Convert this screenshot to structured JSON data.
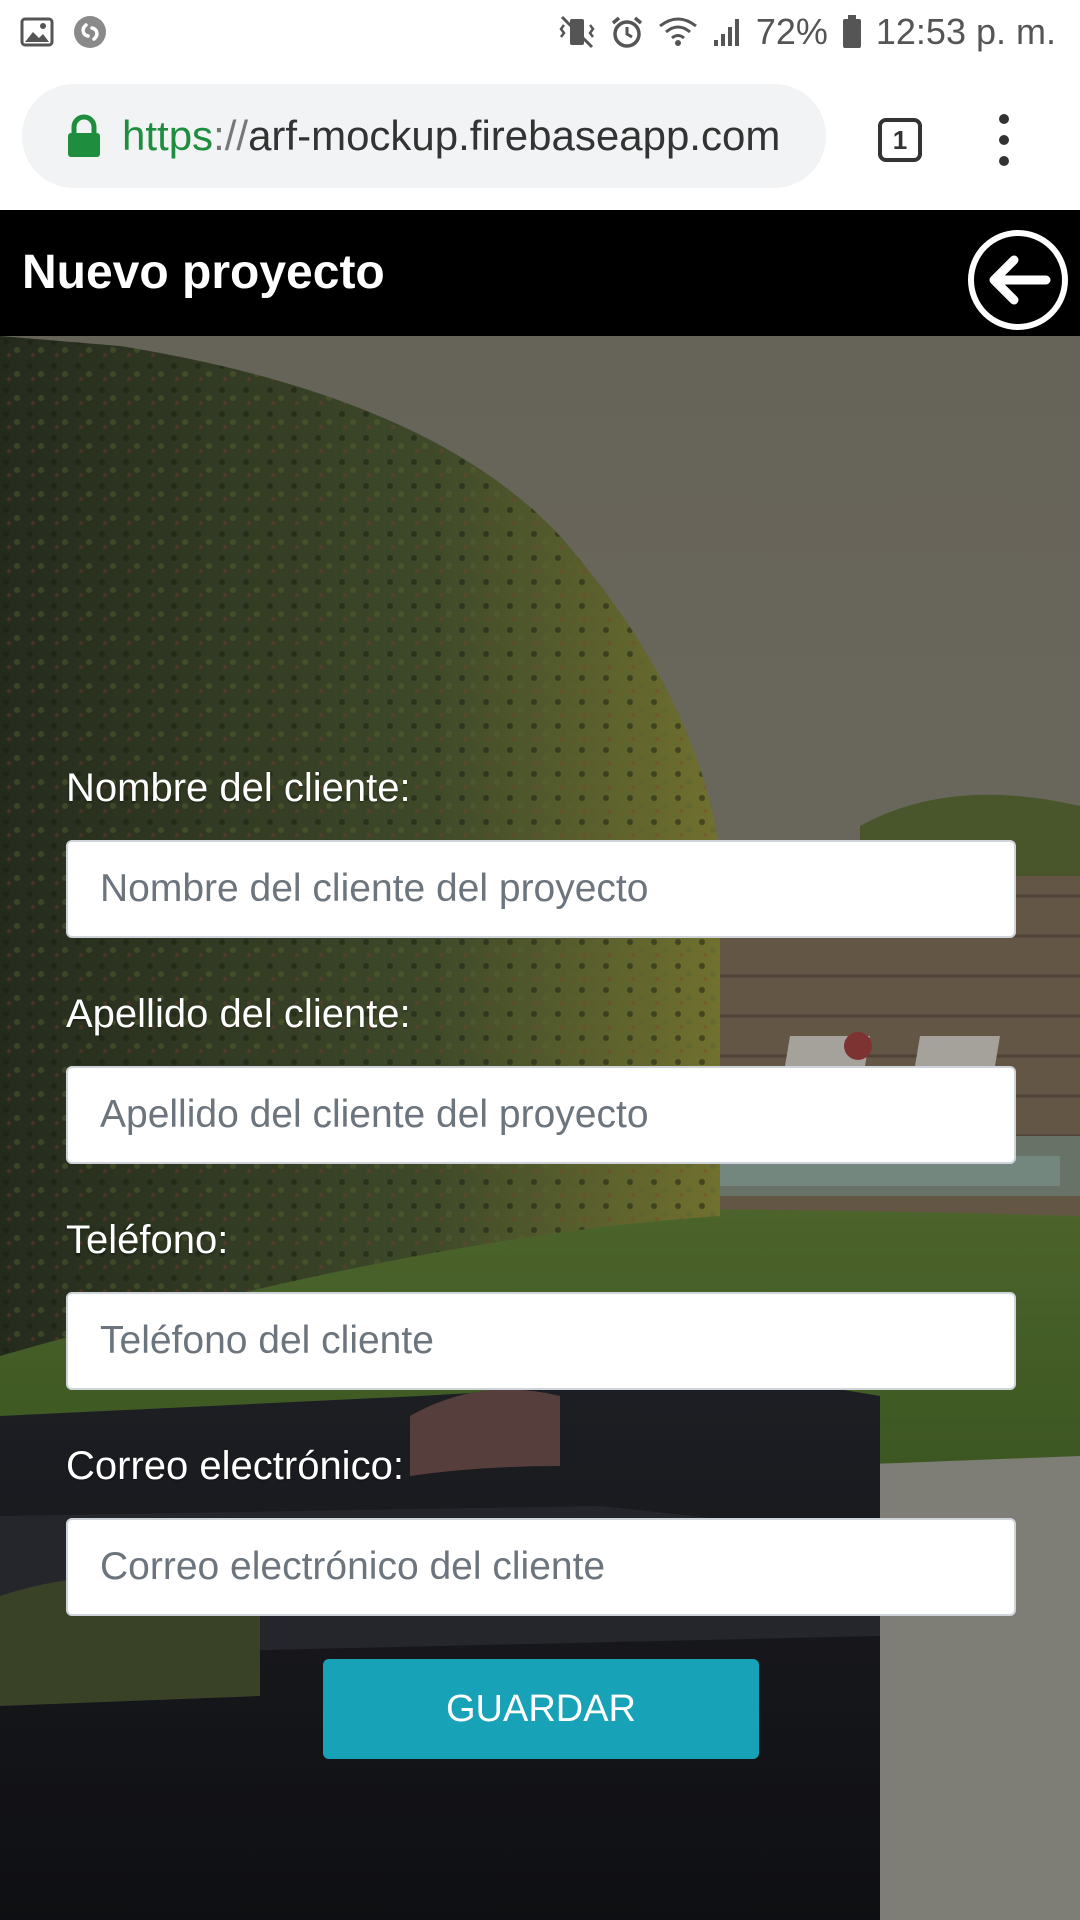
{
  "status_bar": {
    "battery": "72%",
    "time": "12:53 p. m.",
    "icons": [
      "image-icon",
      "shazam-icon",
      "vibrate-mute-icon",
      "alarm-icon",
      "wifi-icon",
      "signal-icon",
      "battery-icon"
    ]
  },
  "browser": {
    "url_scheme": "https",
    "url_separator": "://",
    "url_host": "arf-mockup.firebaseapp.com",
    "tab_count": "1",
    "icons": [
      "lock-icon",
      "tabs-icon",
      "more-vert-icon"
    ]
  },
  "header": {
    "title": "Nuevo proyecto",
    "back_icon": "arrow-left-circle-icon"
  },
  "form": {
    "fields": [
      {
        "label": "Nombre del cliente:",
        "placeholder": "Nombre del cliente del proyecto",
        "value": ""
      },
      {
        "label": "Apellido del cliente:",
        "placeholder": "Apellido del cliente del proyecto",
        "value": ""
      },
      {
        "label": "Teléfono:",
        "placeholder": "Teléfono del cliente",
        "value": ""
      },
      {
        "label": "Correo electrónico:",
        "placeholder": "Correo electrónico del cliente",
        "value": ""
      }
    ],
    "submit_label": "GUARDAR"
  },
  "colors": {
    "header_bg": "#000000",
    "button_bg": "#17a2b8",
    "url_scheme": "#1e8e3e"
  }
}
